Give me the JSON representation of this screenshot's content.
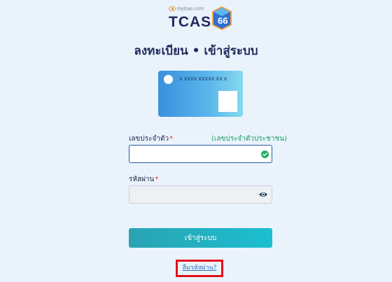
{
  "logo": {
    "site": "mytcas.com",
    "word": "TCAS",
    "number": "66"
  },
  "page_title": "ลงทะเบียน • เข้าสู่ระบบ",
  "card": {
    "number_mask": "X XXXX XXXXX XX X"
  },
  "form": {
    "id_label": "เลขประจำตัว",
    "id_hint": "(เลขประจำตัวประชาชน)",
    "id_value": "",
    "password_label": "รหัสผ่าน",
    "password_value": "",
    "required_mark": "*"
  },
  "login_button": "เข้าสู่ระบบ",
  "forgot_link": "ลืมรหัสผ่าน?",
  "colors": {
    "brand_navy": "#1f2a5c",
    "accent_teal": "#1cbfd0",
    "success_green": "#22b262",
    "highlight_red": "#e0101c"
  }
}
